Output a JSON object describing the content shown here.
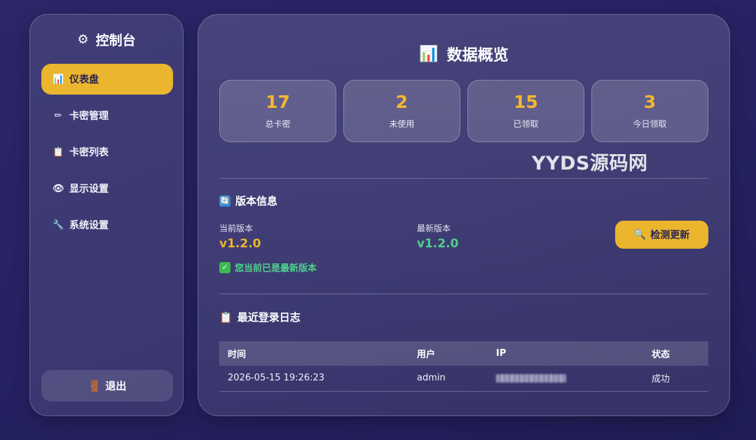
{
  "sidebar": {
    "brand_icon": "⚙",
    "brand_title": "控制台",
    "items": [
      {
        "icon": "📊",
        "label": "仪表盘",
        "active": true
      },
      {
        "icon": "✏",
        "label": "卡密管理"
      },
      {
        "icon": "📋",
        "label": "卡密列表"
      },
      {
        "icon": "👁",
        "label": "显示设置"
      },
      {
        "icon": "🔧",
        "label": "系统设置"
      }
    ],
    "logout_icon": "🚪",
    "logout_label": "退出"
  },
  "main": {
    "title_icon": "📊",
    "title": "数据概览",
    "stats": [
      {
        "value": "17",
        "label": "总卡密"
      },
      {
        "value": "2",
        "label": "未使用"
      },
      {
        "value": "15",
        "label": "已领取"
      },
      {
        "value": "3",
        "label": "今日领取"
      }
    ],
    "watermark": "YYDS源码网",
    "version": {
      "section_icon": "🔄",
      "section_title": "版本信息",
      "current_label": "当前版本",
      "current_value": "v1.2.0",
      "latest_label": "最新版本",
      "latest_value": "v1.2.0",
      "check_icon": "🔍",
      "check_label": "检测更新",
      "status_icon": "✓",
      "status_text": "您当前已是最新版本"
    },
    "logs": {
      "section_icon": "📋",
      "section_title": "最近登录日志",
      "headers": [
        "时间",
        "用户",
        "IP",
        "状态"
      ],
      "rows": [
        {
          "time": "2026-05-15 19:26:23",
          "user": "admin",
          "status": "成功"
        }
      ]
    }
  },
  "colors": {
    "accent": "#ebb52e",
    "stat_number": "#f4b830",
    "success": "#4fd18b",
    "current_version": "#ebb52e",
    "latest_version": "#4fd18b"
  }
}
